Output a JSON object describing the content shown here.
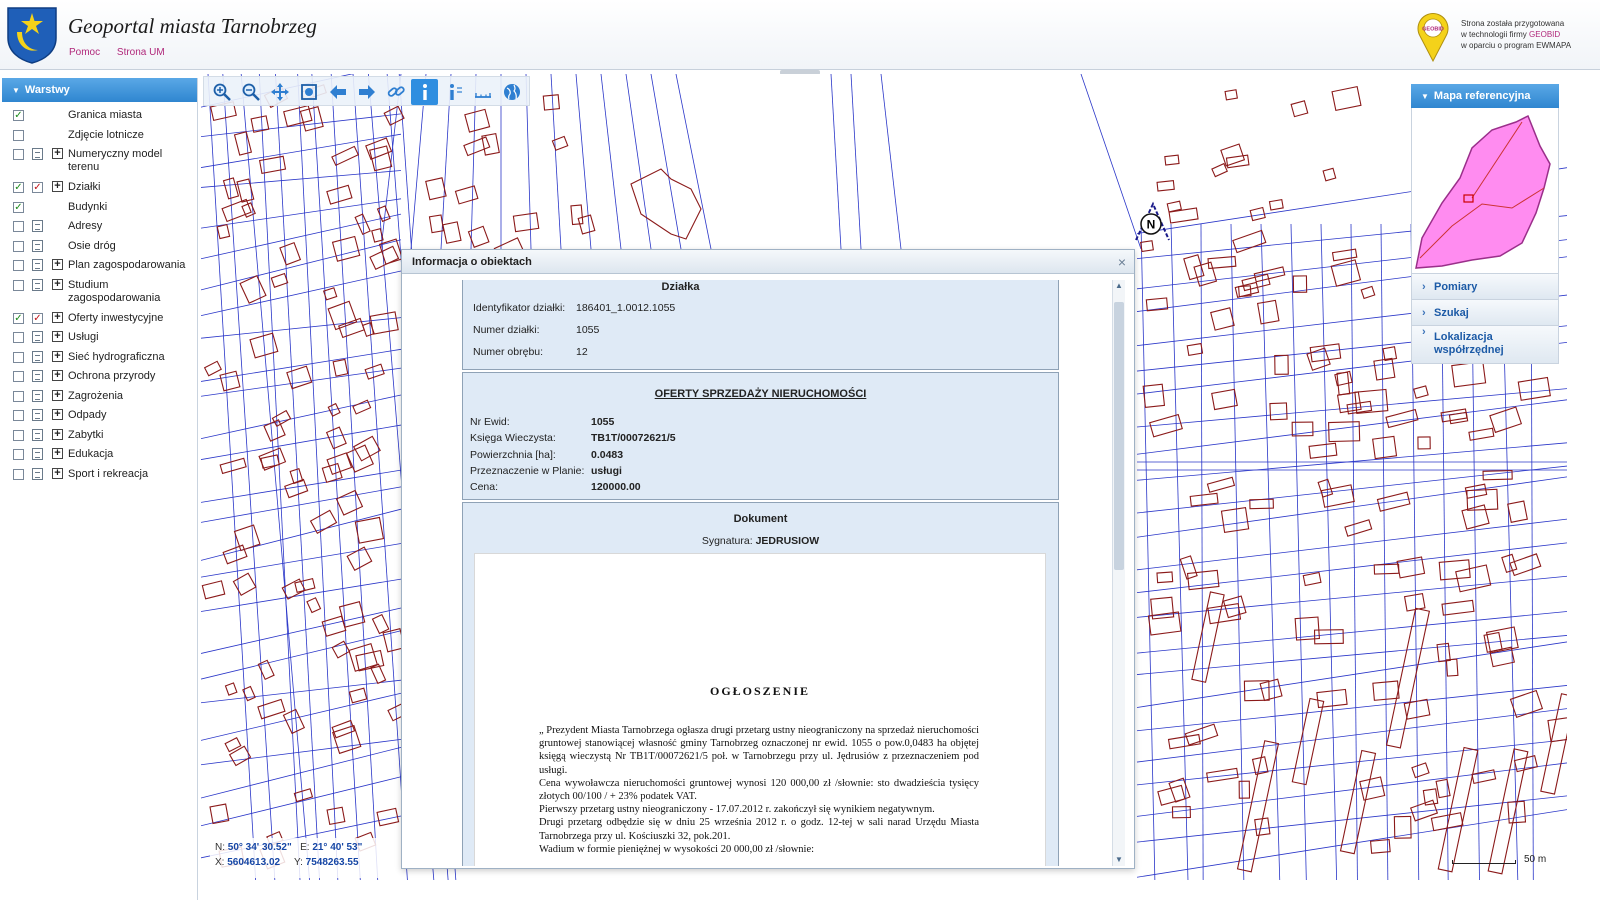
{
  "header": {
    "title": "Geoportal miasta Tarnobrzeg",
    "links": [
      "Pomoc",
      "Strona UM"
    ],
    "note_line1": "Strona została przygotowana",
    "note_line2_prefix": "w technologii firmy ",
    "note_brand": "GEOBID",
    "note_line3": "w oparciu o program EWMAPA",
    "geobid_logo_text": "GEOBID"
  },
  "layers_panel": {
    "title": "Warstwy",
    "items": [
      {
        "label": "Granica miasta",
        "checked": true,
        "doc": false,
        "plus": false,
        "red": false
      },
      {
        "label": "Zdjęcie lotnicze",
        "checked": false,
        "doc": false,
        "plus": false,
        "red": false
      },
      {
        "label": "Numeryczny model terenu",
        "checked": false,
        "doc": true,
        "plus": true,
        "red": false,
        "two_line": true
      },
      {
        "label": "Działki",
        "checked": true,
        "doc": false,
        "plus": true,
        "red": true
      },
      {
        "label": "Budynki",
        "checked": true,
        "doc": false,
        "plus": false,
        "red": false
      },
      {
        "label": "Adresy",
        "checked": false,
        "doc": true,
        "plus": false,
        "red": false
      },
      {
        "label": "Osie dróg",
        "checked": false,
        "doc": true,
        "plus": false,
        "red": false
      },
      {
        "label": "Plan zagospodarowania",
        "checked": false,
        "doc": true,
        "plus": true,
        "red": false
      },
      {
        "label": "Studium zagospodarowania",
        "checked": false,
        "doc": true,
        "plus": true,
        "red": false,
        "two_line": true
      },
      {
        "label": "Oferty inwestycyjne",
        "checked": true,
        "doc": false,
        "plus": true,
        "red": true
      },
      {
        "label": "Usługi",
        "checked": false,
        "doc": true,
        "plus": true,
        "red": false
      },
      {
        "label": "Sieć hydrograficzna",
        "checked": false,
        "doc": true,
        "plus": true,
        "red": false
      },
      {
        "label": "Ochrona przyrody",
        "checked": false,
        "doc": true,
        "plus": true,
        "red": false
      },
      {
        "label": "Zagrożenia",
        "checked": false,
        "doc": true,
        "plus": true,
        "red": false
      },
      {
        "label": "Odpady",
        "checked": false,
        "doc": true,
        "plus": true,
        "red": false
      },
      {
        "label": "Zabytki",
        "checked": false,
        "doc": true,
        "plus": true,
        "red": false
      },
      {
        "label": "Edukacja",
        "checked": false,
        "doc": true,
        "plus": true,
        "red": false
      },
      {
        "label": "Sport i rekreacja",
        "checked": false,
        "doc": true,
        "plus": true,
        "red": false
      }
    ]
  },
  "toolbar": {
    "tools": [
      "zoom-in-icon",
      "zoom-out-icon",
      "pan-icon",
      "zoom-extent-icon",
      "back-arrow-icon",
      "forward-arrow-icon",
      "link-icon",
      "info-icon",
      "info-list-icon",
      "measure-icon",
      "globe-icon"
    ],
    "active_tool": "info-icon"
  },
  "right_panel": {
    "ref_title": "Mapa referencyjna",
    "items": [
      "Pomiary",
      "Szukaj",
      "Lokalizacja współrzędnej"
    ]
  },
  "map": {
    "north_label": "N",
    "coords": {
      "n_label": "N:",
      "n_value": "50° 34' 30.52\"",
      "e_label": "E:",
      "e_value": "21° 40' 53\"",
      "x_label": "X:",
      "x_value": "5604613.02",
      "y_label": "Y:",
      "y_value": "7548263.55"
    },
    "scale_label": "50 m",
    "colors": {
      "parcel": "#2a36c8",
      "building": "#8b1a1a",
      "reference_fill": "#ff8cf0"
    }
  },
  "dialog": {
    "title": "Informacja o obiektach",
    "close": "×",
    "dzialka": {
      "header": "Działka",
      "rows": [
        {
          "k": "Identyfikator działki:",
          "v": "186401_1.0012.1055"
        },
        {
          "k": "Numer działki:",
          "v": "1055"
        },
        {
          "k": "Numer obrębu:",
          "v": "12"
        }
      ]
    },
    "oferty": {
      "header": "OFERTY SPRZEDAŻY NIERUCHOMOŚCI",
      "rows": [
        {
          "k": "Nr Ewid:",
          "v": "1055"
        },
        {
          "k": "Księga Wieczysta:",
          "v": "TB1T/00072621/5"
        },
        {
          "k": "Powierzchnia [ha]:",
          "v": "0.0483"
        },
        {
          "k": "Przeznaczenie w Planie:",
          "v": "usługi"
        },
        {
          "k": "Cena:",
          "v": "120000.00"
        }
      ]
    },
    "dokument": {
      "header": "Dokument",
      "signature_label": "Sygnatura:",
      "signature_value": "JEDRUSIOW",
      "scan_title": "OGŁOSZENIE",
      "scan_lines": [
        "„ Prezydent Miasta Tarnobrzega ogłasza drugi przetarg ustny nieograniczony na sprzedaż nieruchomości gruntowej stanowiącej własność gminy Tarnobrzeg oznaczonej nr ewid. 1055 o pow.0,0483 ha objętej księgą wieczystą Nr TB1T/00072621/5 poł. w Tarnobrzegu przy ul. Jędrusiów z przeznaczeniem pod usługi.",
        "Cena wywoławcza nieruchomości gruntowej wynosi 120 000,00 zł /słownie: sto dwadzieścia tysięcy złotych 00/100 / + 23% podatek VAT.",
        "Pierwszy przetarg ustny nieograniczony - 17.07.2012 r. zakończył się wynikiem negatywnym.",
        "Drugi przetarg odbędzie się w dniu 25 września 2012 r. o godz. 12-tej w sali narad Urzędu Miasta Tarnobrzega przy ul. Kościuszki 32, pok.201.",
        "Wadium w formie pieniężnej w wysokości 20 000,00 zł /słownie:"
      ]
    }
  }
}
